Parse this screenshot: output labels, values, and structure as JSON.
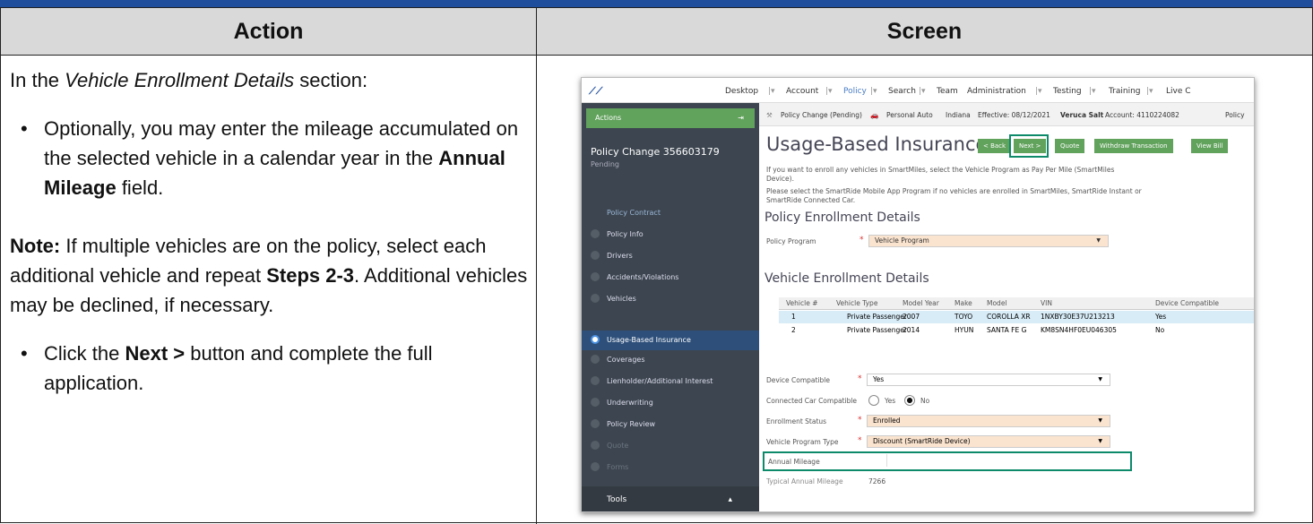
{
  "header": {
    "action": "Action",
    "screen": "Screen"
  },
  "action": {
    "intro_pre": "In the ",
    "intro_em": "Vehicle Enrollment Details",
    "intro_post": " section:",
    "b1_pre": "Optionally, you may enter the mileage accumulated on the selected vehicle in a calendar year in the ",
    "b1_bold": "Annual Mileage",
    "b1_post": " field.",
    "note_bold": "Note:",
    "note_text": " If multiple vehicles are on the policy, select each additional vehicle and repeat ",
    "note_steps": "Steps 2-3",
    "note_post": ". Additional vehicles may be declined, if necessary.",
    "b2_pre": "Click the ",
    "b2_bold": "Next >",
    "b2_post": " button and complete the full application."
  },
  "shot": {
    "nav": [
      "Desktop",
      "Account",
      "Policy",
      "Search",
      "Team",
      "Administration",
      "Testing",
      "Training",
      "Live C"
    ],
    "sidebar": {
      "actions": "Actions",
      "title": "Policy Change 356603179",
      "status": "Pending",
      "items": [
        "Policy Contract",
        "Policy Info",
        "Drivers",
        "Accidents/Violations",
        "Vehicles",
        "Usage-Based Insurance",
        "Coverages",
        "Lienholder/Additional Interest",
        "Underwriting",
        "Policy Review",
        "Quote",
        "Forms"
      ],
      "tools": "Tools"
    },
    "infobar": {
      "change": "Policy Change (Pending)",
      "line": "Personal Auto",
      "state": "Indiana",
      "effective": "Effective: 08/12/2021",
      "insured": "Veruca Salt",
      "account": "Account: 4110224082",
      "policy": "Policy"
    },
    "page_title": "Usage-Based Insurance",
    "buttons": [
      "< Back",
      "Next >",
      "Quote",
      "Withdraw Transaction",
      "View Bill"
    ],
    "msg1": "If you want to enroll any vehicles in SmartMiles, select the Vehicle Program as Pay Per Mile (SmartMiles Device).",
    "msg2": "Please select the SmartRide Mobile App Program if no vehicles are enrolled in SmartMiles, SmartRide Instant or SmartRide Connected Car.",
    "sec1": "Policy Enrollment Details",
    "policy_program_label": "Policy Program",
    "policy_program_value": "Vehicle Program",
    "sec2": "Vehicle Enrollment Details",
    "table": {
      "headers": [
        "Vehicle #",
        "Vehicle Type",
        "Model Year",
        "Make",
        "Model",
        "VIN",
        "Device Compatible"
      ],
      "rows": [
        [
          "1",
          "Private Passenger",
          "2007",
          "TOYO",
          "COROLLA XR",
          "1NXBY30E37U213213",
          "Yes"
        ],
        [
          "2",
          "Private Passenger",
          "2014",
          "HYUN",
          "SANTA FE G",
          "KM8SN4HF0EU046305",
          "No"
        ]
      ]
    },
    "form": {
      "device_compatible_label": "Device Compatible",
      "device_compatible_value": "Yes",
      "connected_label": "Connected Car Compatible",
      "yes": "Yes",
      "no": "No",
      "enroll_label": "Enrollment Status",
      "enroll_value": "Enrolled",
      "vpt_label": "Vehicle Program Type",
      "vpt_value": "Discount (SmartRide Device)",
      "mileage_label": "Annual Mileage",
      "typical_label": "Typical Annual Mileage",
      "typical_value": "7266"
    }
  },
  "colors": {
    "accent": "#1f4e9c",
    "green": "#61a25c",
    "highlight": "#0c8a6a"
  }
}
